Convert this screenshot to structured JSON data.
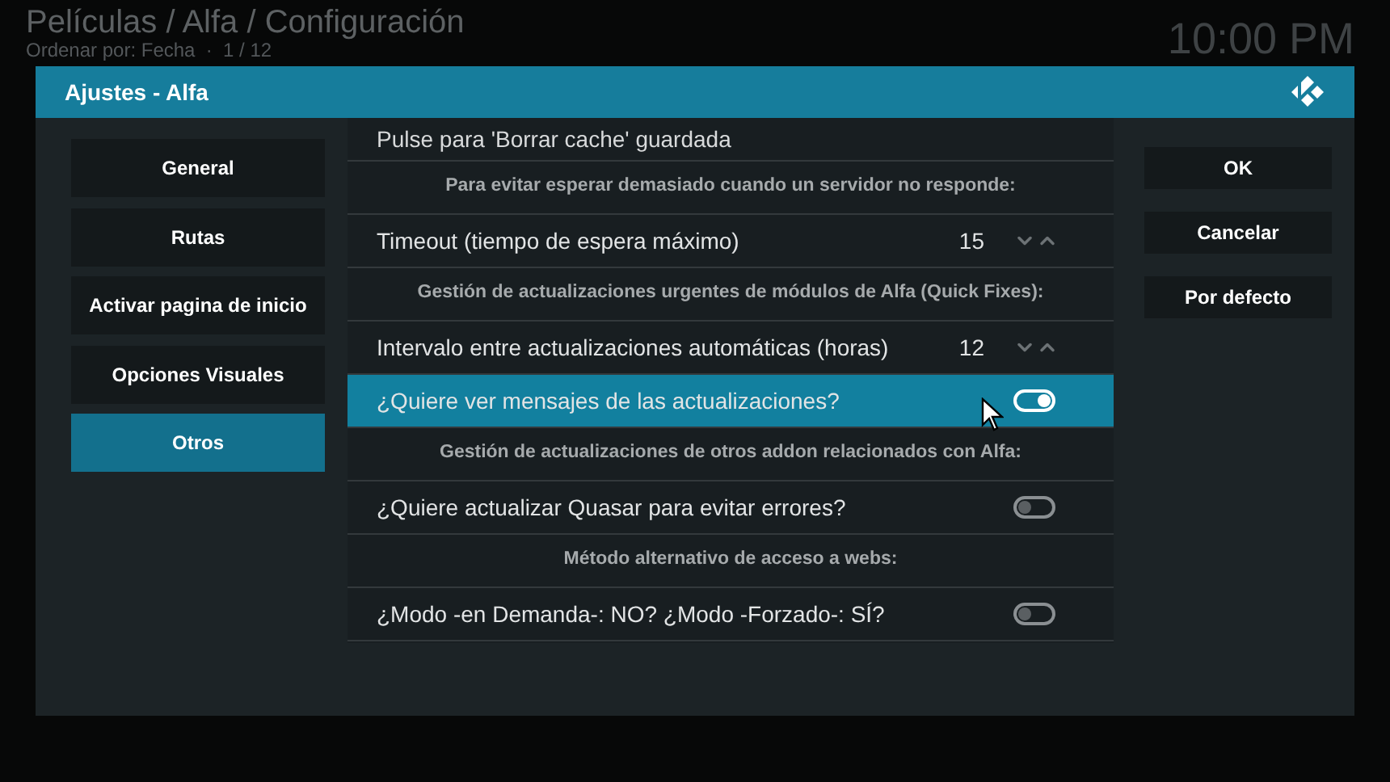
{
  "header": {
    "title": "Películas / Alfa / Configuración",
    "subtitle": "Ordenar por: Fecha  ·  1 / 12",
    "clock": "10:00 PM"
  },
  "dialog": {
    "title": "Ajustes - Alfa",
    "categories": [
      {
        "label": "General",
        "selected": false
      },
      {
        "label": "Rutas",
        "selected": false
      },
      {
        "label": "Activar pagina de inicio",
        "selected": false
      },
      {
        "label": "Opciones Visuales",
        "selected": false
      },
      {
        "label": "Otros",
        "selected": true
      }
    ],
    "settings": [
      {
        "kind": "action",
        "label": "Pulse para 'Borrar cache' guardada",
        "selected": false
      },
      {
        "kind": "header",
        "label": "Para evitar esperar demasiado cuando un servidor no responde:",
        "selected": false
      },
      {
        "kind": "spin",
        "label": "Timeout (tiempo de espera máximo)",
        "value": "15",
        "selected": false
      },
      {
        "kind": "header",
        "label": "Gestión de actualizaciones urgentes de módulos de Alfa (Quick Fixes):",
        "selected": false
      },
      {
        "kind": "spin",
        "label": "Intervalo entre actualizaciones automáticas (horas)",
        "value": "12",
        "selected": false
      },
      {
        "kind": "toggle",
        "label": "¿Quiere ver mensajes de las actualizaciones?",
        "on": true,
        "selected": true
      },
      {
        "kind": "header",
        "label": "Gestión de actualizaciones de otros addon relacionados con Alfa:",
        "selected": false
      },
      {
        "kind": "toggle",
        "label": "¿Quiere actualizar Quasar para evitar errores?",
        "on": false,
        "selected": false
      },
      {
        "kind": "header",
        "label": "Método alternativo de acceso a webs:",
        "selected": false
      },
      {
        "kind": "toggle",
        "label": "¿Modo -en Demanda-: NO? ¿Modo -Forzado-: SÍ?",
        "on": false,
        "selected": false
      }
    ],
    "buttons": [
      "OK",
      "Cancelar",
      "Por defecto"
    ]
  }
}
